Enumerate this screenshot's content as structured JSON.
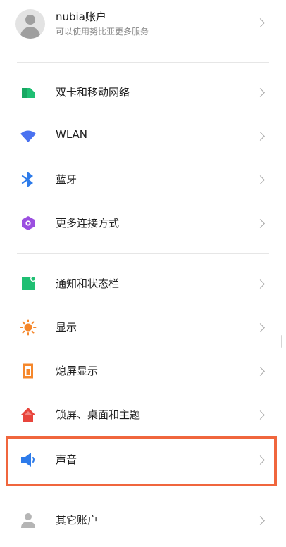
{
  "account": {
    "title": "nubia账户",
    "subtitle": "可以使用努比亚更多服务"
  },
  "section1": [
    {
      "label": "双卡和移动网络",
      "icon": "sim-card-icon",
      "color": "#1fbf73"
    },
    {
      "label": "WLAN",
      "icon": "wifi-icon",
      "color": "#4a72f0"
    },
    {
      "label": "蓝牙",
      "icon": "bluetooth-icon",
      "color": "#2d7bea"
    },
    {
      "label": "更多连接方式",
      "icon": "hexagon-connection-icon",
      "color": "#9b4fe0"
    }
  ],
  "section2": [
    {
      "label": "通知和状态栏",
      "icon": "notification-icon",
      "color": "#1fbf73"
    },
    {
      "label": "显示",
      "icon": "sun-icon",
      "color": "#f5872b"
    },
    {
      "label": "熄屏显示",
      "icon": "screen-off-icon",
      "color": "#f5872b"
    },
    {
      "label": "锁屏、桌面和主题",
      "icon": "home-icon",
      "color": "#e8453c"
    },
    {
      "label": "声音",
      "icon": "speaker-icon",
      "color": "#2d7bea"
    }
  ],
  "section3": [
    {
      "label": "其它账户",
      "icon": "person-icon",
      "color": "#b5b5b5"
    }
  ],
  "highlight_color": "#f0663d"
}
